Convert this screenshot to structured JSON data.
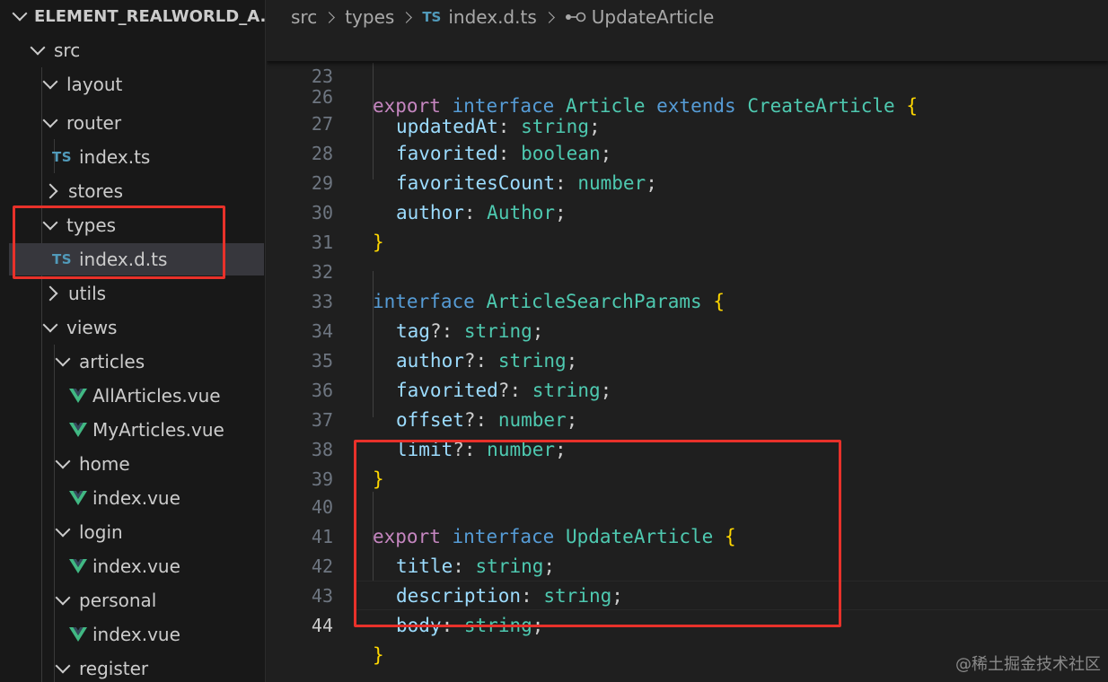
{
  "explorer": {
    "root": "ELEMENT_REALWORLD_A...",
    "items": [
      {
        "label": "src",
        "kind": "folder-open"
      },
      {
        "label": "layout",
        "kind": "folder-open"
      },
      {
        "label": "router",
        "kind": "folder-open"
      },
      {
        "label": "index.ts",
        "kind": "ts-file"
      },
      {
        "label": "stores",
        "kind": "folder-closed"
      },
      {
        "label": "types",
        "kind": "folder-open"
      },
      {
        "label": "index.d.ts",
        "kind": "ts-file",
        "selected": true
      },
      {
        "label": "utils",
        "kind": "folder-closed"
      },
      {
        "label": "views",
        "kind": "folder-open"
      },
      {
        "label": "articles",
        "kind": "folder-open"
      },
      {
        "label": "AllArticles.vue",
        "kind": "vue-file"
      },
      {
        "label": "MyArticles.vue",
        "kind": "vue-file"
      },
      {
        "label": "home",
        "kind": "folder-open"
      },
      {
        "label": "index.vue",
        "kind": "vue-file"
      },
      {
        "label": "login",
        "kind": "folder-open"
      },
      {
        "label": "index.vue",
        "kind": "vue-file"
      },
      {
        "label": "personal",
        "kind": "folder-open"
      },
      {
        "label": "index.vue",
        "kind": "vue-file"
      },
      {
        "label": "register",
        "kind": "folder-open"
      }
    ],
    "ts_badge": "TS"
  },
  "breadcrumb": {
    "parts": [
      "src",
      "types",
      "index.d.ts",
      "UpdateArticle"
    ],
    "ts_badge": "TS"
  },
  "sticky": {
    "line_number": "23",
    "tokens": {
      "t1": "export",
      "t2": "interface",
      "t3": "Article",
      "t4": "extends",
      "t5": "CreateArticle",
      "t6": "{"
    }
  },
  "code": [
    {
      "n": "26",
      "tokens": {
        "p": "updatedAt",
        "c": ":",
        "t": "string",
        "e": ";"
      }
    },
    {
      "n": "27",
      "tokens": {
        "p": "favorited",
        "c": ":",
        "t": "boolean",
        "e": ";"
      }
    },
    {
      "n": "28",
      "tokens": {
        "p": "favoritesCount",
        "c": ":",
        "t": "number",
        "e": ";"
      }
    },
    {
      "n": "29",
      "tokens": {
        "p": "author",
        "c": ":",
        "t": "Author",
        "e": ";"
      }
    },
    {
      "n": "30",
      "tokens": {
        "b": "}"
      }
    },
    {
      "n": "31",
      "tokens": {}
    },
    {
      "n": "32",
      "tokens": {
        "s": "interface",
        "t": "ArticleSearchParams",
        "b": "{"
      }
    },
    {
      "n": "33",
      "tokens": {
        "p": "tag",
        "c": "?:",
        "t": "string",
        "e": ";"
      }
    },
    {
      "n": "34",
      "tokens": {
        "p": "author",
        "c": "?:",
        "t": "string",
        "e": ";"
      }
    },
    {
      "n": "35",
      "tokens": {
        "p": "favorited",
        "c": "?:",
        "t": "string",
        "e": ";"
      }
    },
    {
      "n": "36",
      "tokens": {
        "p": "offset",
        "c": "?:",
        "t": "number",
        "e": ";"
      }
    },
    {
      "n": "37",
      "tokens": {
        "p": "limit",
        "c": "?:",
        "t": "number",
        "e": ";"
      }
    },
    {
      "n": "38",
      "tokens": {
        "b": "}"
      }
    },
    {
      "n": "39",
      "tokens": {}
    },
    {
      "n": "40",
      "tokens": {
        "k": "export",
        "s": "interface",
        "t": "UpdateArticle",
        "b": "{"
      }
    },
    {
      "n": "41",
      "tokens": {
        "p": "title",
        "c": ":",
        "t": "string",
        "e": ";"
      }
    },
    {
      "n": "42",
      "tokens": {
        "p": "description",
        "c": ":",
        "t": "string",
        "e": ";"
      }
    },
    {
      "n": "43",
      "tokens": {
        "p": "body",
        "c": ":",
        "t": "string",
        "e": ";"
      }
    },
    {
      "n": "44",
      "tokens": {
        "b": "}"
      }
    }
  ],
  "watermark": "@稀土掘金技术社区",
  "colors": {
    "annotation": "#e8312a",
    "ts": "#519aba",
    "vue": "#41b883"
  }
}
